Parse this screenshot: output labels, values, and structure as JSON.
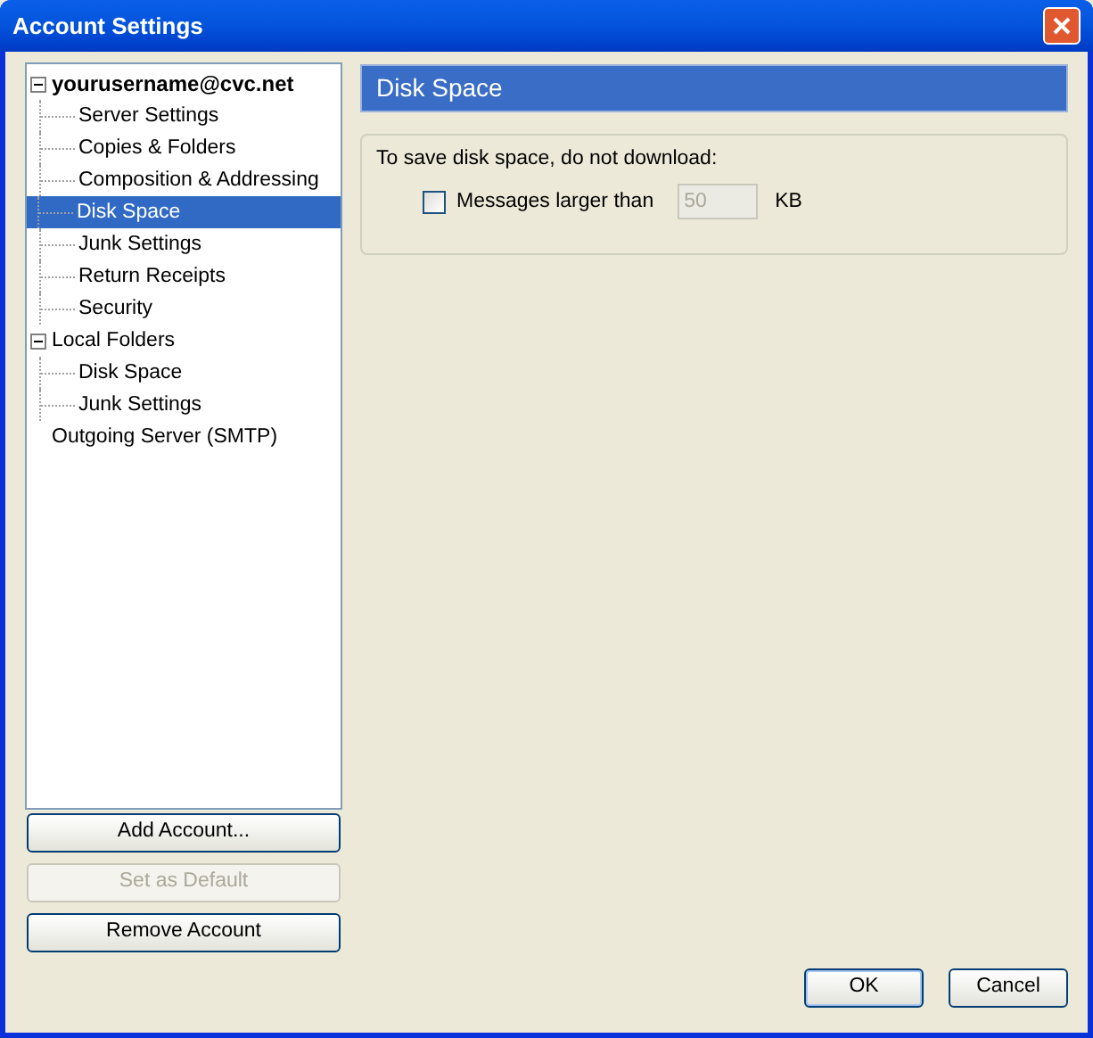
{
  "window": {
    "title": "Account Settings"
  },
  "tree": [
    {
      "label": "yourusername@cvc.net",
      "bold": true,
      "expanded": true,
      "selected": false,
      "children": [
        {
          "label": "Server Settings",
          "selected": false
        },
        {
          "label": "Copies & Folders",
          "selected": false
        },
        {
          "label": "Composition & Addressing",
          "selected": false
        },
        {
          "label": "Disk Space",
          "selected": true
        },
        {
          "label": "Junk Settings",
          "selected": false
        },
        {
          "label": "Return Receipts",
          "selected": false
        },
        {
          "label": "Security",
          "selected": false
        }
      ]
    },
    {
      "label": "Local Folders",
      "bold": false,
      "expanded": true,
      "selected": false,
      "children": [
        {
          "label": "Disk Space",
          "selected": false
        },
        {
          "label": "Junk Settings",
          "selected": false
        }
      ]
    },
    {
      "label": "Outgoing Server (SMTP)",
      "bold": false,
      "selected": false
    }
  ],
  "account_buttons": [
    {
      "label": "Add Account...",
      "disabled": false
    },
    {
      "label": "Set as Default",
      "disabled": true
    },
    {
      "label": "Remove Account",
      "disabled": false
    }
  ],
  "panel": {
    "title": "Disk Space",
    "group_label": "To save disk space, do not download:",
    "option": {
      "label": "Messages larger than",
      "checked": false,
      "value": "50",
      "disabled": true,
      "unit": "KB"
    }
  },
  "dialog_buttons": [
    {
      "label": "OK",
      "default": true
    },
    {
      "label": "Cancel",
      "default": false
    }
  ]
}
